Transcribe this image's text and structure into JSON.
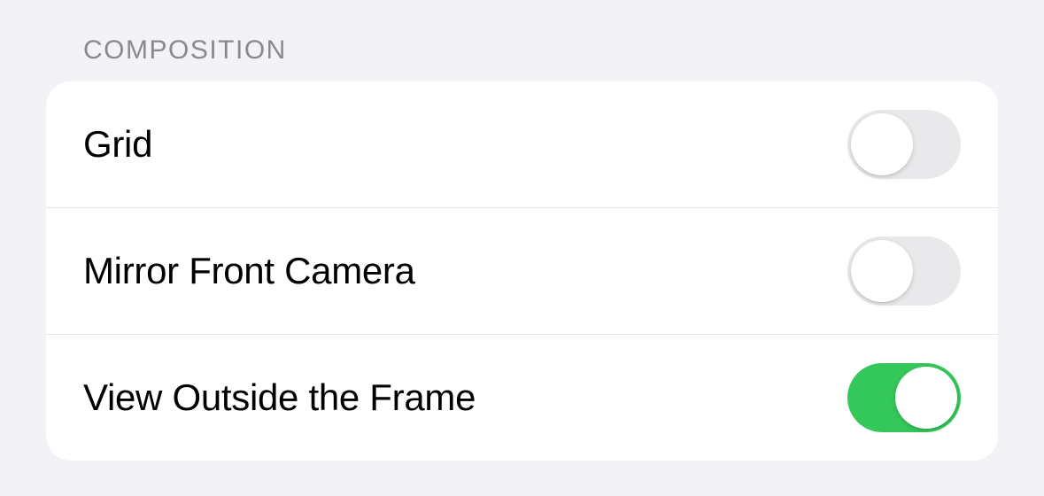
{
  "section": {
    "header": "COMPOSITION",
    "rows": [
      {
        "id": "grid",
        "label": "Grid",
        "enabled": false
      },
      {
        "id": "mirror-front-camera",
        "label": "Mirror Front Camera",
        "enabled": false
      },
      {
        "id": "view-outside-frame",
        "label": "View Outside the Frame",
        "enabled": true
      }
    ]
  },
  "colors": {
    "background": "#f2f2f7",
    "groupBackground": "#ffffff",
    "separator": "#e5e5ea",
    "headerText": "#8a8a8e",
    "labelText": "#000000",
    "toggleOff": "#e9e9eb",
    "toggleOn": "#34c759",
    "toggleKnob": "#ffffff"
  }
}
